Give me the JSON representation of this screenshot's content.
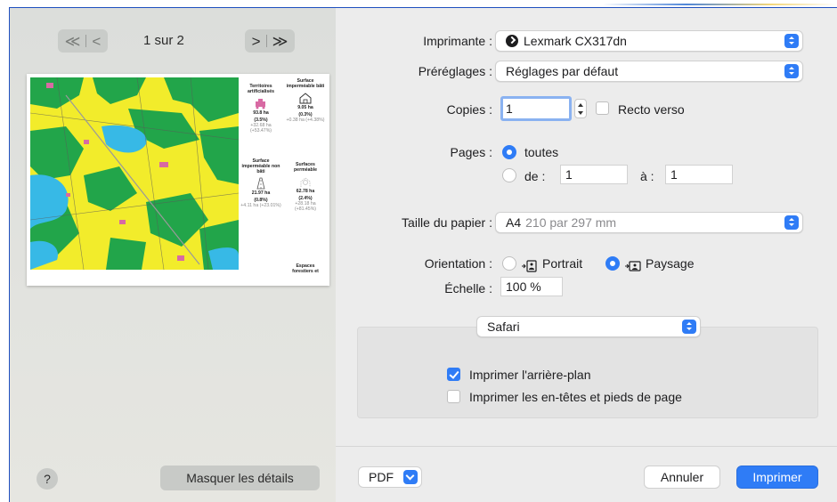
{
  "preview": {
    "nav_prev_glyphs": "≪ | <",
    "nav_next_glyphs": "> | ≫",
    "page_indicator": "1 sur 2",
    "stats": [
      {
        "title": "Territoires artificialisés",
        "value": "93.8 ha",
        "pct": "(3.5%)",
        "delta": "+32.68 ha (+53.47%)"
      },
      {
        "title": "Surface imperméable bâti",
        "value": "9.05 ha",
        "pct": "(0.3%)",
        "delta": "+0.38 ha (+4.38%)"
      },
      {
        "title": "Surface imperméable non bâti",
        "value": "21.97 ha",
        "pct": "(0.8%)",
        "delta": "+4.11 ha (+23.01%)"
      },
      {
        "title": "Surfaces perméable",
        "value": "62.78 ha",
        "pct": "(2.4%)",
        "delta": "+28.18 ha (+81.45%)"
      },
      {
        "title": "Espaces forestiers et",
        "value": "",
        "pct": "",
        "delta": ""
      }
    ]
  },
  "footer_left": {
    "help_label": "?",
    "hide_details_label": "Masquer les détails"
  },
  "form": {
    "printer_label": "Imprimante :",
    "printer_value": "Lexmark CX317dn",
    "presets_label": "Préréglages :",
    "presets_value": "Réglages par défaut",
    "copies_label": "Copies :",
    "copies_value": "1",
    "duplex_label": "Recto verso",
    "duplex_checked": false,
    "pages_label": "Pages :",
    "pages_all_label": "toutes",
    "pages_range_label": "de :",
    "pages_from": "1",
    "pages_to_label": "à :",
    "pages_to": "1",
    "paper_label": "Taille du papier :",
    "paper_value": "A4",
    "paper_detail": "210 par 297 mm",
    "orientation_label": "Orientation :",
    "orientation_portrait": "Portrait",
    "orientation_landscape": "Paysage",
    "orientation_selected": "Paysage",
    "scale_label": "Échelle :",
    "scale_value": "100 %",
    "app_section_value": "Safari",
    "print_background_label": "Imprimer l'arrière-plan",
    "print_background_checked": true,
    "print_headers_label": "Imprimer les en-têtes et pieds de page",
    "print_headers_checked": false
  },
  "footer_right": {
    "pdf_label": "PDF",
    "cancel_label": "Annuler",
    "print_label": "Imprimer"
  },
  "colors": {
    "accent": "#2f7cf6",
    "map_forest": "#22a54a",
    "map_agri": "#f2ec2b",
    "map_water": "#37b9e6",
    "map_urban": "#d86aa3"
  }
}
